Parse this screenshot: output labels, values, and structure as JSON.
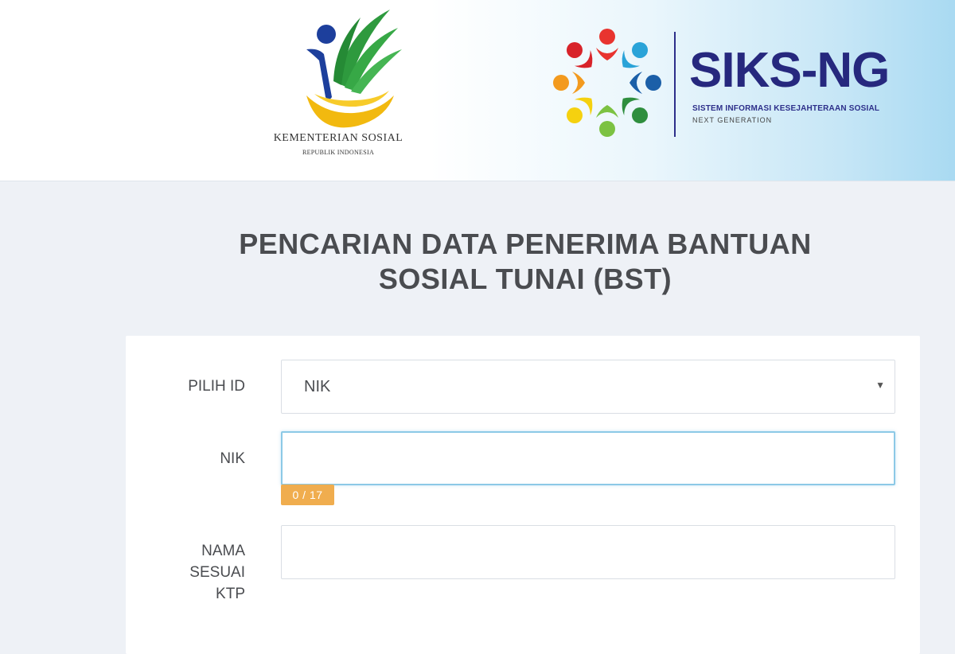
{
  "header": {
    "kemensos": {
      "name": "KEMENTERIAN SOSIAL",
      "subtitle": "REPUBLIK INDONESIA"
    },
    "siks": {
      "title": "SIKS-NG",
      "subtitle": "SISTEM INFORMASI KESEJAHTERAAN SOSIAL",
      "tagline": "NEXT GENERATION"
    }
  },
  "page": {
    "title_line1": "PENCARIAN DATA PENERIMA BANTUAN",
    "title_line2": "SOSIAL TUNAI (BST)"
  },
  "form": {
    "pilih_id": {
      "label": "PILIH ID",
      "selected": "NIK"
    },
    "nik": {
      "label": "NIK",
      "value": "",
      "counter": "0 / 17"
    },
    "nama": {
      "label_line1": "NAMA",
      "label_line2": "SESUAI",
      "label_line3": "KTP",
      "value": ""
    }
  },
  "colors": {
    "navy": "#26287e",
    "title_gray": "#4a4c50",
    "badge_orange": "#f0ad4e",
    "focus_blue": "#8cc9e6"
  },
  "icons": {
    "select_caret": "caret-down-icon"
  }
}
